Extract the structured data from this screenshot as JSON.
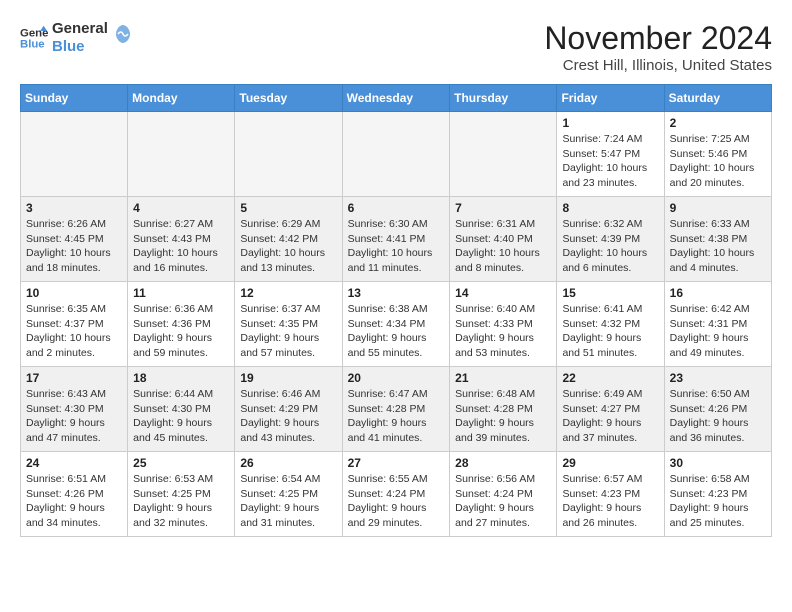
{
  "logo": {
    "line1": "General",
    "line2": "Blue"
  },
  "title": "November 2024",
  "location": "Crest Hill, Illinois, United States",
  "days_of_week": [
    "Sunday",
    "Monday",
    "Tuesday",
    "Wednesday",
    "Thursday",
    "Friday",
    "Saturday"
  ],
  "weeks": [
    [
      {
        "day": "",
        "info": ""
      },
      {
        "day": "",
        "info": ""
      },
      {
        "day": "",
        "info": ""
      },
      {
        "day": "",
        "info": ""
      },
      {
        "day": "",
        "info": ""
      },
      {
        "day": "1",
        "info": "Sunrise: 7:24 AM\nSunset: 5:47 PM\nDaylight: 10 hours and 23 minutes."
      },
      {
        "day": "2",
        "info": "Sunrise: 7:25 AM\nSunset: 5:46 PM\nDaylight: 10 hours and 20 minutes."
      }
    ],
    [
      {
        "day": "3",
        "info": "Sunrise: 6:26 AM\nSunset: 4:45 PM\nDaylight: 10 hours and 18 minutes."
      },
      {
        "day": "4",
        "info": "Sunrise: 6:27 AM\nSunset: 4:43 PM\nDaylight: 10 hours and 16 minutes."
      },
      {
        "day": "5",
        "info": "Sunrise: 6:29 AM\nSunset: 4:42 PM\nDaylight: 10 hours and 13 minutes."
      },
      {
        "day": "6",
        "info": "Sunrise: 6:30 AM\nSunset: 4:41 PM\nDaylight: 10 hours and 11 minutes."
      },
      {
        "day": "7",
        "info": "Sunrise: 6:31 AM\nSunset: 4:40 PM\nDaylight: 10 hours and 8 minutes."
      },
      {
        "day": "8",
        "info": "Sunrise: 6:32 AM\nSunset: 4:39 PM\nDaylight: 10 hours and 6 minutes."
      },
      {
        "day": "9",
        "info": "Sunrise: 6:33 AM\nSunset: 4:38 PM\nDaylight: 10 hours and 4 minutes."
      }
    ],
    [
      {
        "day": "10",
        "info": "Sunrise: 6:35 AM\nSunset: 4:37 PM\nDaylight: 10 hours and 2 minutes."
      },
      {
        "day": "11",
        "info": "Sunrise: 6:36 AM\nSunset: 4:36 PM\nDaylight: 9 hours and 59 minutes."
      },
      {
        "day": "12",
        "info": "Sunrise: 6:37 AM\nSunset: 4:35 PM\nDaylight: 9 hours and 57 minutes."
      },
      {
        "day": "13",
        "info": "Sunrise: 6:38 AM\nSunset: 4:34 PM\nDaylight: 9 hours and 55 minutes."
      },
      {
        "day": "14",
        "info": "Sunrise: 6:40 AM\nSunset: 4:33 PM\nDaylight: 9 hours and 53 minutes."
      },
      {
        "day": "15",
        "info": "Sunrise: 6:41 AM\nSunset: 4:32 PM\nDaylight: 9 hours and 51 minutes."
      },
      {
        "day": "16",
        "info": "Sunrise: 6:42 AM\nSunset: 4:31 PM\nDaylight: 9 hours and 49 minutes."
      }
    ],
    [
      {
        "day": "17",
        "info": "Sunrise: 6:43 AM\nSunset: 4:30 PM\nDaylight: 9 hours and 47 minutes."
      },
      {
        "day": "18",
        "info": "Sunrise: 6:44 AM\nSunset: 4:30 PM\nDaylight: 9 hours and 45 minutes."
      },
      {
        "day": "19",
        "info": "Sunrise: 6:46 AM\nSunset: 4:29 PM\nDaylight: 9 hours and 43 minutes."
      },
      {
        "day": "20",
        "info": "Sunrise: 6:47 AM\nSunset: 4:28 PM\nDaylight: 9 hours and 41 minutes."
      },
      {
        "day": "21",
        "info": "Sunrise: 6:48 AM\nSunset: 4:28 PM\nDaylight: 9 hours and 39 minutes."
      },
      {
        "day": "22",
        "info": "Sunrise: 6:49 AM\nSunset: 4:27 PM\nDaylight: 9 hours and 37 minutes."
      },
      {
        "day": "23",
        "info": "Sunrise: 6:50 AM\nSunset: 4:26 PM\nDaylight: 9 hours and 36 minutes."
      }
    ],
    [
      {
        "day": "24",
        "info": "Sunrise: 6:51 AM\nSunset: 4:26 PM\nDaylight: 9 hours and 34 minutes."
      },
      {
        "day": "25",
        "info": "Sunrise: 6:53 AM\nSunset: 4:25 PM\nDaylight: 9 hours and 32 minutes."
      },
      {
        "day": "26",
        "info": "Sunrise: 6:54 AM\nSunset: 4:25 PM\nDaylight: 9 hours and 31 minutes."
      },
      {
        "day": "27",
        "info": "Sunrise: 6:55 AM\nSunset: 4:24 PM\nDaylight: 9 hours and 29 minutes."
      },
      {
        "day": "28",
        "info": "Sunrise: 6:56 AM\nSunset: 4:24 PM\nDaylight: 9 hours and 27 minutes."
      },
      {
        "day": "29",
        "info": "Sunrise: 6:57 AM\nSunset: 4:23 PM\nDaylight: 9 hours and 26 minutes."
      },
      {
        "day": "30",
        "info": "Sunrise: 6:58 AM\nSunset: 4:23 PM\nDaylight: 9 hours and 25 minutes."
      }
    ]
  ]
}
